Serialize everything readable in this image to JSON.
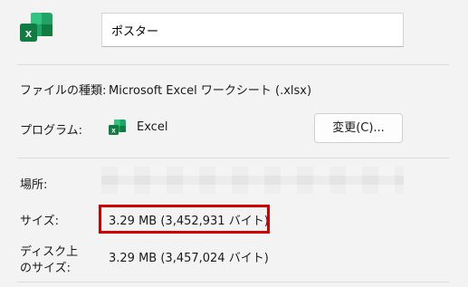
{
  "file": {
    "name": "ポスター",
    "type_label": "ファイルの種類:",
    "type_value": "Microsoft Excel ワークシート (.xlsx)",
    "program_label": "プログラム:",
    "program_name": "Excel",
    "change_button_label": "変更(C)...",
    "location_label": "場所:",
    "size_label": "サイズ:",
    "size_value": "3.29 MB (3,452,931 バイト)",
    "disk_size_label_line1": "ディスク上",
    "disk_size_label_line2": "のサイズ:",
    "disk_size_value": "3.29 MB (3,457,024 バイト)"
  },
  "colors": {
    "excel_green": "#107c41",
    "excel_light_green": "#21a366",
    "highlight_red": "#d00000"
  },
  "icons": {
    "file_icon": "excel-file-icon",
    "program_icon": "excel-app-icon"
  }
}
